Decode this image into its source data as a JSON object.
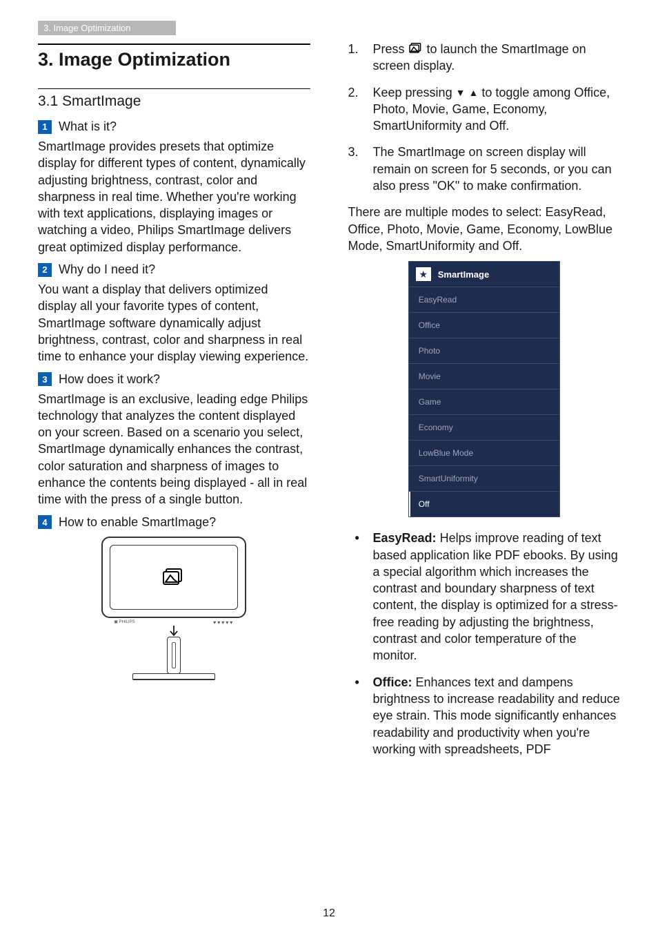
{
  "header_bar": "3. Image Optimization",
  "chapter_title": "3.  Image Optimization",
  "section_title": "3.1  SmartImage",
  "q1_label": "What is it?",
  "q1_body": "SmartImage provides presets that optimize display for different types of content, dynamically adjusting brightness, contrast, color and sharpness in real time. Whether you're working with text applications, displaying images or watching a video, Philips SmartImage delivers great optimized display performance.",
  "q2_label": "Why do I need it?",
  "q2_body": "You want a display that delivers optimized display all your favorite types of content, SmartImage software dynamically adjust brightness, contrast, color and sharpness in real time to enhance your display viewing experience.",
  "q3_label": "How does it work?",
  "q3_body": "SmartImage is an exclusive, leading edge Philips technology that analyzes the content displayed on your screen. Based on a scenario you select, SmartImage dynamically enhances the contrast, color saturation and sharpness of images to enhance the contents being displayed - all in real time with the press of a single button.",
  "q4_label": "How to enable SmartImage?",
  "step1_a": "Press ",
  "step1_b": " to launch the SmartImage on screen display.",
  "step2_a": "Keep pressing ",
  "step2_b": " to toggle among Office, Photo, Movie, Game, Economy, SmartUniformity and Off.",
  "step3": "The SmartImage on screen display will remain on screen for 5 seconds, or you can also press \"OK\" to make confirmation.",
  "modes_intro": "There are multiple modes to select: EasyRead, Office, Photo, Movie, Game, Economy, LowBlue Mode, SmartUniformity and Off.",
  "osd": {
    "title": "SmartImage",
    "items": [
      "EasyRead",
      "Office",
      "Photo",
      "Movie",
      "Game",
      "Economy",
      "LowBlue Mode",
      "SmartUniformity",
      "Off"
    ],
    "selected": "Off"
  },
  "bullet_easyread_term": "EasyRead:",
  "bullet_easyread_body": " Helps improve reading of text based application like PDF ebooks. By using a special algorithm which increases the contrast and boundary sharpness of text content, the display is optimized for a stress-free reading by adjusting the brightness, contrast and color temperature of the monitor.",
  "bullet_office_term": "Office:",
  "bullet_office_body": " Enhances text and dampens brightness to increase readability and reduce eye strain. This mode significantly enhances readability and productivity when you're working with spreadsheets, PDF",
  "page_number": "12"
}
